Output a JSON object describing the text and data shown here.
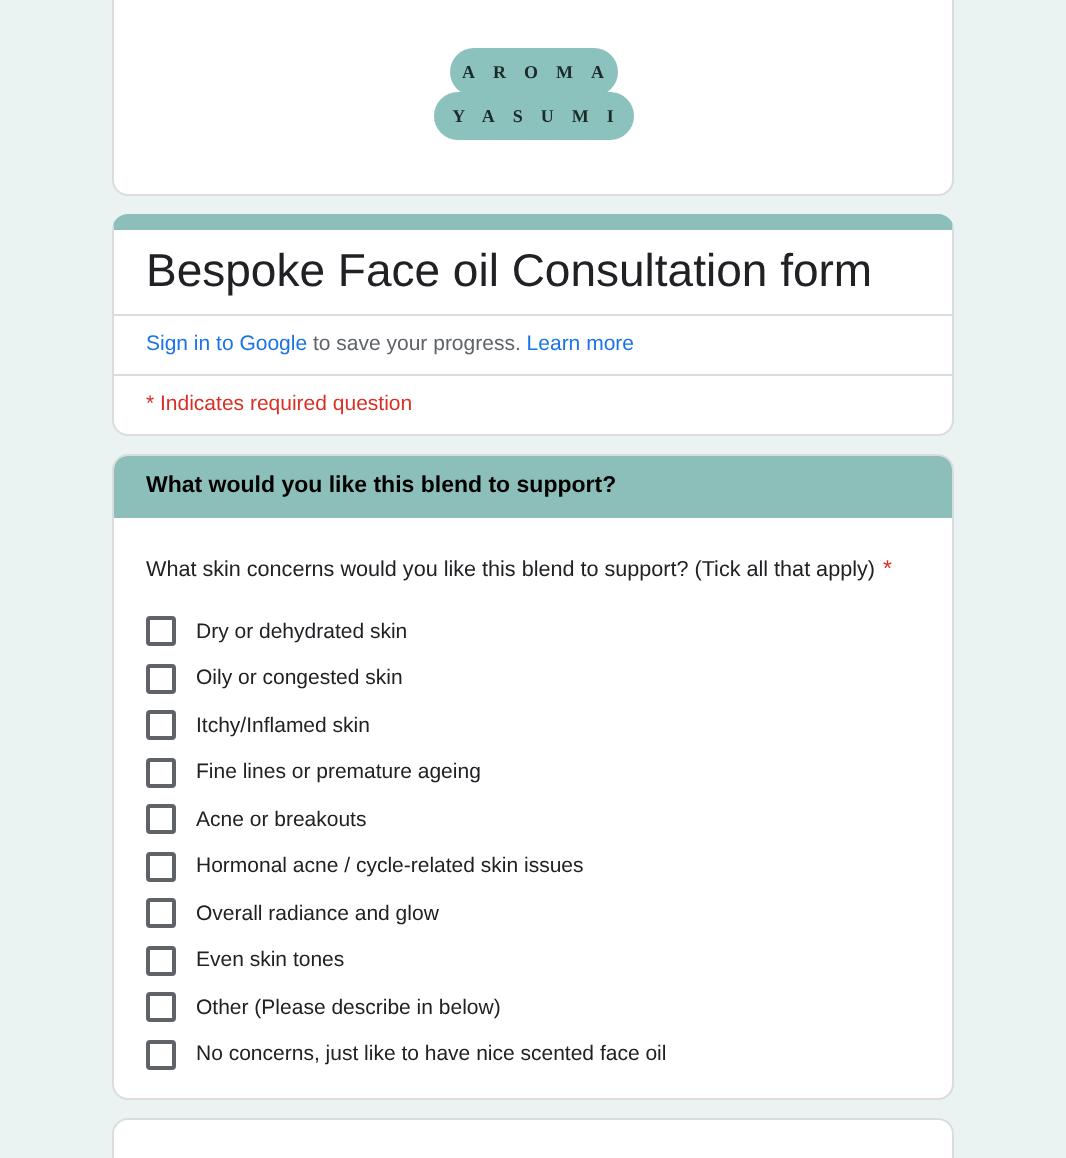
{
  "logo": {
    "lines": [
      "AROMA",
      "YASUMI"
    ]
  },
  "form": {
    "title": "Bespoke Face oil Consultation form",
    "sign_in_link": "Sign in to Google",
    "sign_in_text": "to save your progress.",
    "learn_more": "Learn more",
    "required_note": "* Indicates required question"
  },
  "section": {
    "title": "What would you like this blend to support?"
  },
  "question": {
    "text": "What skin concerns would you like this blend to support? (Tick all that apply)",
    "required_mark": "*",
    "options": [
      {
        "label": "Dry or dehydrated skin",
        "checked": false
      },
      {
        "label": "Oily or congested skin",
        "checked": false
      },
      {
        "label": "Itchy/Inflamed skin",
        "checked": false
      },
      {
        "label": "Fine lines or premature ageing",
        "checked": false
      },
      {
        "label": "Acne or breakouts",
        "checked": false
      },
      {
        "label": "Hormonal acne / cycle-related skin issues",
        "checked": false
      },
      {
        "label": "Overall radiance and glow",
        "checked": false
      },
      {
        "label": "Even skin tones",
        "checked": false
      },
      {
        "label": "Other (Please describe in below)",
        "checked": false
      },
      {
        "label": "No concerns, just like to have nice scented face oil",
        "checked": false
      }
    ]
  }
}
